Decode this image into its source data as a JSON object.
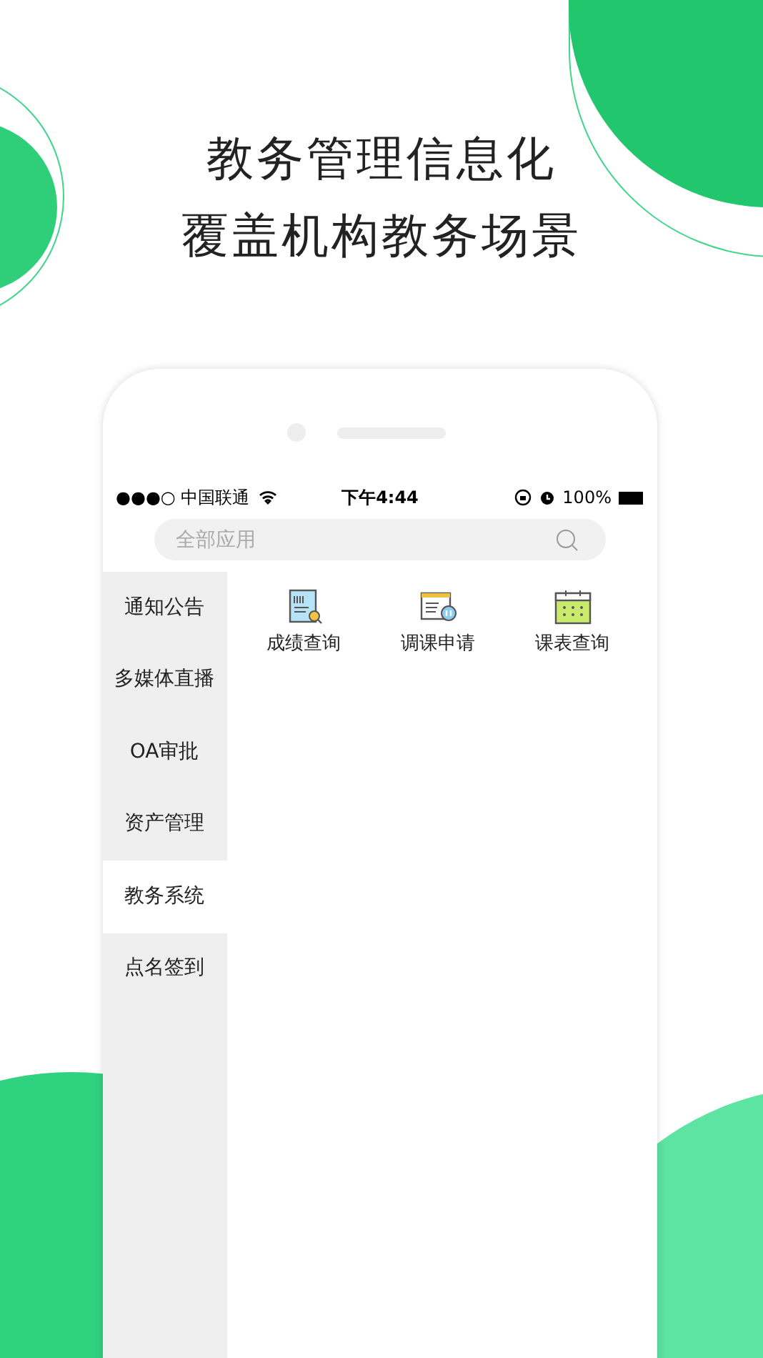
{
  "headline": [
    "教务管理信息化",
    "覆盖机构教务场景"
  ],
  "status_bar": {
    "carrier": "●●●○ 中国联通",
    "time": "下午4:44",
    "battery": "100%"
  },
  "search": {
    "placeholder": "全部应用"
  },
  "sidebar": {
    "items": [
      {
        "label": "通知公告",
        "selected": false
      },
      {
        "label": "多媒体直播",
        "selected": false
      },
      {
        "label": "OA审批",
        "selected": false
      },
      {
        "label": "资产管理",
        "selected": false
      },
      {
        "label": "教务系统",
        "selected": true
      },
      {
        "label": "点名签到",
        "selected": false
      }
    ]
  },
  "apps": [
    {
      "label": "成绩查询",
      "kind": "grades"
    },
    {
      "label": "调课申请",
      "kind": "reschedule"
    },
    {
      "label": "课表查询",
      "kind": "timetable"
    }
  ]
}
